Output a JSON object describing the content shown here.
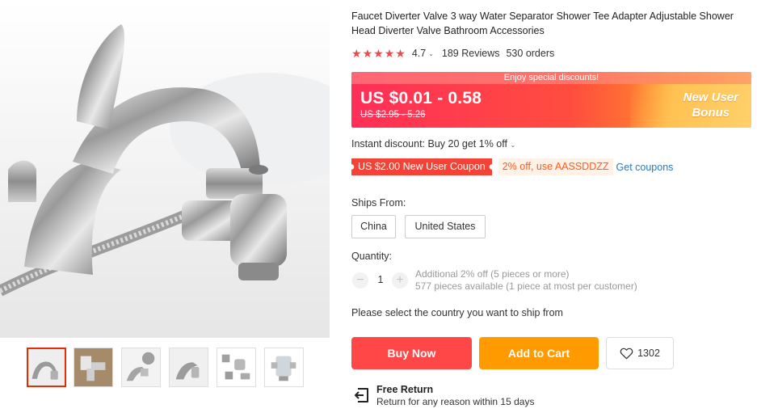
{
  "product": {
    "title": "Faucet Diverter Valve 3 way Water Separator Shower Tee Adapter Adjustable Shower Head Diverter Valve Bathroom Accessories",
    "rating": "4.7",
    "reviews": "189 Reviews",
    "orders": "530 orders",
    "stars_filled": 5
  },
  "price": {
    "strip": "Enjoy special discounts!",
    "current": "US $0.01 - 0.58",
    "original": "US $2.95 - 5.26",
    "bonus_line1": "New User",
    "bonus_line2": "Bonus"
  },
  "promo": {
    "instant_discount": "Instant discount: Buy 20 get 1% off",
    "new_user_coupon": "US $2.00 New User Coupon",
    "code_coupon": "2% off, use AASSDDZZ",
    "get_coupons": "Get coupons"
  },
  "shipping": {
    "label": "Ships From:",
    "options": [
      "China",
      "United States"
    ]
  },
  "quantity": {
    "label": "Quantity:",
    "value": "1",
    "minus": "−",
    "plus": "+",
    "info_line1": "Additional 2% off (5 pieces or more)",
    "info_line2": "577 pieces available (1 piece at most per customer)"
  },
  "ship_notice": "Please select the country you want to ship from",
  "actions": {
    "buy_now": "Buy Now",
    "add_to_cart": "Add to Cart",
    "wishlist_count": "1302"
  },
  "return_policy": {
    "title": "Free Return",
    "description": "Return for any reason within 15 days"
  },
  "colors": {
    "buy_now": "#ff4747",
    "add_to_cart": "#ff9a00",
    "star": "#f04848",
    "link": "#2e7ab8",
    "thumb_active": "#e62e04"
  },
  "icons": {
    "rating_star": "★",
    "caret": "⌄",
    "wishlist": "heart-icon",
    "return": "return-icon"
  }
}
